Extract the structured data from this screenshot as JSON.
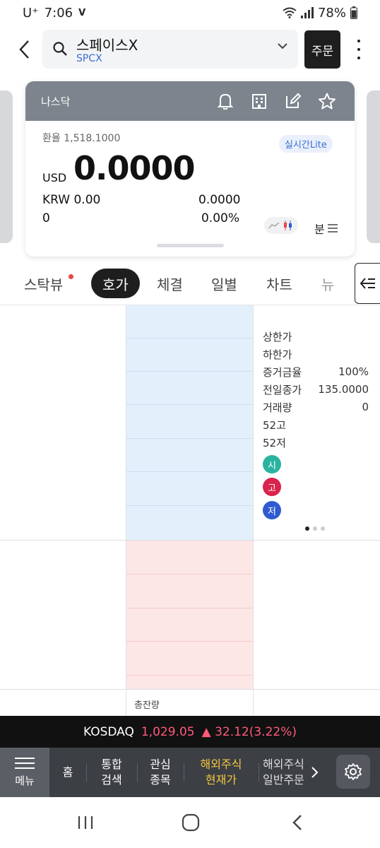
{
  "status_bar": {
    "carrier": "U⁺",
    "time": "7:06",
    "battery": "78%"
  },
  "header": {
    "stock_name": "스페이스X",
    "stock_code": "SPCX",
    "order_label": "주문"
  },
  "card": {
    "market": "나스닥",
    "exchange_rate": "환율 1,518.1000",
    "realtime_badge": "실시간Lite",
    "currency": "USD",
    "price": "0.0000",
    "krw_label": "KRW 0.00",
    "krw_change": "0.0000",
    "change": "0",
    "change_pct": "0.00%",
    "split_label": "분"
  },
  "tabs": [
    {
      "label": "스탁뷰"
    },
    {
      "label": "호가"
    },
    {
      "label": "체결"
    },
    {
      "label": "일별"
    },
    {
      "label": "차트"
    },
    {
      "label": "뉴"
    }
  ],
  "info_panel": {
    "rows": [
      {
        "label": "상한가",
        "value": ""
      },
      {
        "label": "하한가",
        "value": ""
      },
      {
        "label": "증거금율",
        "value": "100%"
      },
      {
        "label": "전일종가",
        "value": "135.0000"
      },
      {
        "label": "거래량",
        "value": "0"
      },
      {
        "label": "52고",
        "value": ""
      },
      {
        "label": "52저",
        "value": ""
      }
    ],
    "badges": [
      {
        "label": "시",
        "color": "#2bb3a0"
      },
      {
        "label": "고",
        "color": "#d9234b"
      },
      {
        "label": "저",
        "color": "#2f5bd0"
      }
    ]
  },
  "order_book": {
    "total_label": "총잔량"
  },
  "ticker": {
    "index_name": "KOSDAQ",
    "index_value": "1,029.05",
    "index_change": "▲ 32.12(3.22%)"
  },
  "bottom_nav": {
    "menu_label": "메뉴",
    "items": [
      {
        "label": "홈"
      },
      {
        "label": "통합\n검색"
      },
      {
        "label": "관심\n종목"
      },
      {
        "label": "해외주식\n현재가"
      },
      {
        "label": "해외주식\n일반주문"
      }
    ]
  },
  "colors": {
    "ask_bg": "#e3effb",
    "bid_bg": "#fde6e6",
    "highlight": "#f6c83e",
    "up": "#ff5a7a"
  }
}
